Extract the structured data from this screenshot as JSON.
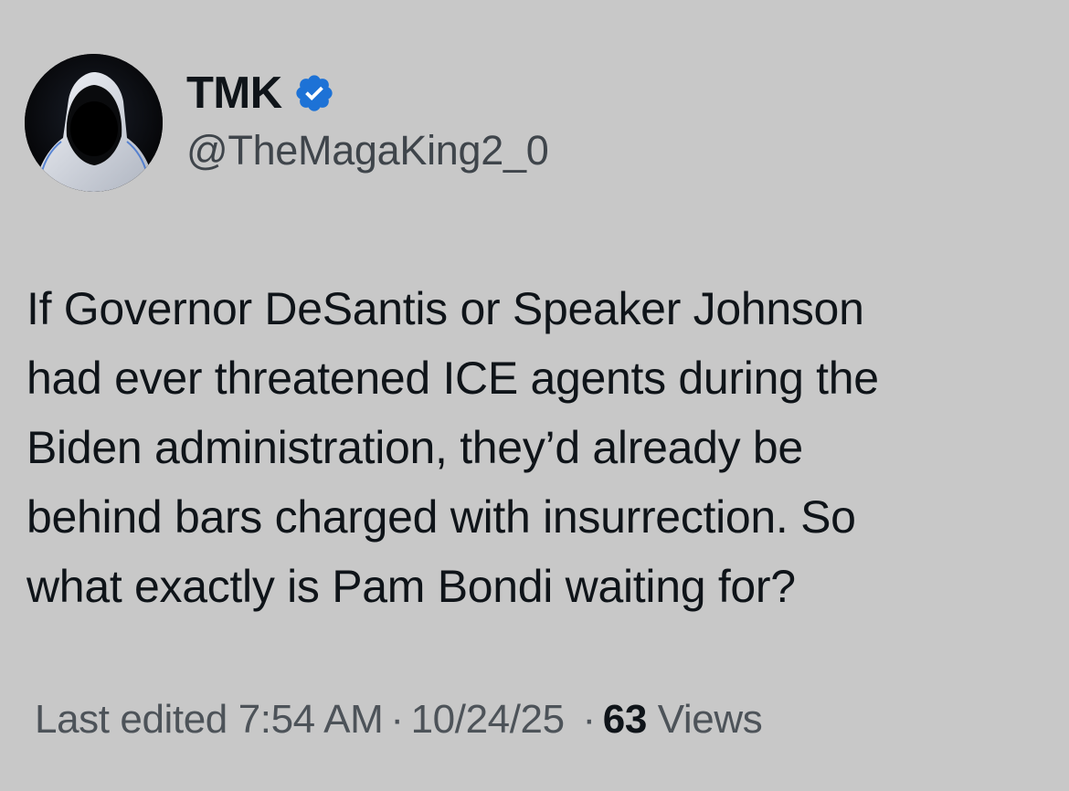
{
  "author": {
    "display_name": "TMK",
    "handle": "@TheMagaKing2_0",
    "verified": true,
    "avatar_icon": "hooded-figure-avatar",
    "verified_color": "#1d72d6"
  },
  "tweet": {
    "lines": [
      "If Governor DeSantis or Speaker Johnson",
      "had ever threatened ICE agents during the",
      "Biden administration, they’d already be",
      "behind bars charged with insurrection. So",
      "what exactly is Pam Bondi waiting for?"
    ]
  },
  "meta": {
    "edited_label": "Last edited",
    "time": "7:54 AM",
    "separator": "·",
    "date": "10/24/25",
    "views_count": "63",
    "views_label": "Views"
  }
}
